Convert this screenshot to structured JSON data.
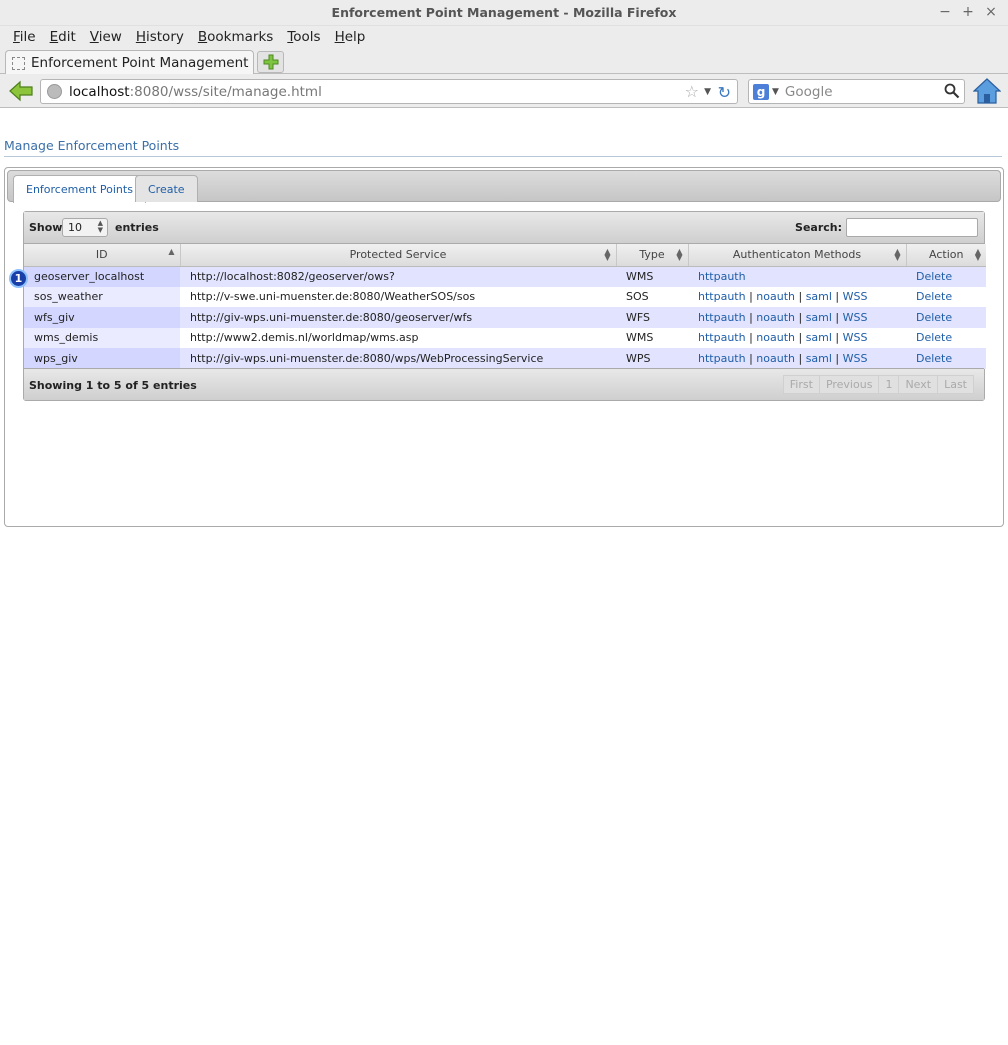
{
  "window": {
    "title": "Enforcement Point Management - Mozilla Firefox"
  },
  "menu": [
    "File",
    "Edit",
    "View",
    "History",
    "Bookmarks",
    "Tools",
    "Help"
  ],
  "browser_tab": {
    "title": "Enforcement Point Management"
  },
  "url": {
    "host": "localhost",
    "path": ":8080/wss/site/manage.html"
  },
  "search": {
    "placeholder": "Google"
  },
  "page": {
    "title": "Manage Enforcement Points",
    "tabs": [
      "Enforcement Points",
      "Create"
    ],
    "table": {
      "show_label": "Show",
      "length_value": "10",
      "entries_label": "entries",
      "search_label": "Search:",
      "columns": [
        "ID",
        "Protected Service",
        "Type",
        "Authenticaton Methods",
        "Action"
      ],
      "rows": [
        {
          "id": "geoserver_localhost",
          "service": "http://localhost:8082/geoserver/ows?",
          "type": "WMS",
          "methods": [
            "httpauth"
          ],
          "action": "Delete"
        },
        {
          "id": "sos_weather",
          "service": "http://v-swe.uni-muenster.de:8080/WeatherSOS/sos",
          "type": "SOS",
          "methods": [
            "httpauth",
            "noauth",
            "saml",
            "WSS"
          ],
          "action": "Delete"
        },
        {
          "id": "wfs_giv",
          "service": "http://giv-wps.uni-muenster.de:8080/geoserver/wfs",
          "type": "WFS",
          "methods": [
            "httpauth",
            "noauth",
            "saml",
            "WSS"
          ],
          "action": "Delete"
        },
        {
          "id": "wms_demis",
          "service": "http://www2.demis.nl/worldmap/wms.asp",
          "type": "WMS",
          "methods": [
            "httpauth",
            "noauth",
            "saml",
            "WSS"
          ],
          "action": "Delete"
        },
        {
          "id": "wps_giv",
          "service": "http://giv-wps.uni-muenster.de:8080/wps/WebProcessingService",
          "type": "WPS",
          "methods": [
            "httpauth",
            "noauth",
            "saml",
            "WSS"
          ],
          "action": "Delete"
        }
      ],
      "info": "Showing 1 to 5 of 5 entries",
      "pager": [
        "First",
        "Previous",
        "1",
        "Next",
        "Last"
      ],
      "marker": "1"
    }
  },
  "colors": {
    "link": "#1f5ea8",
    "odd_row": "#e2e4ff",
    "badge": "#1a3ea8"
  }
}
